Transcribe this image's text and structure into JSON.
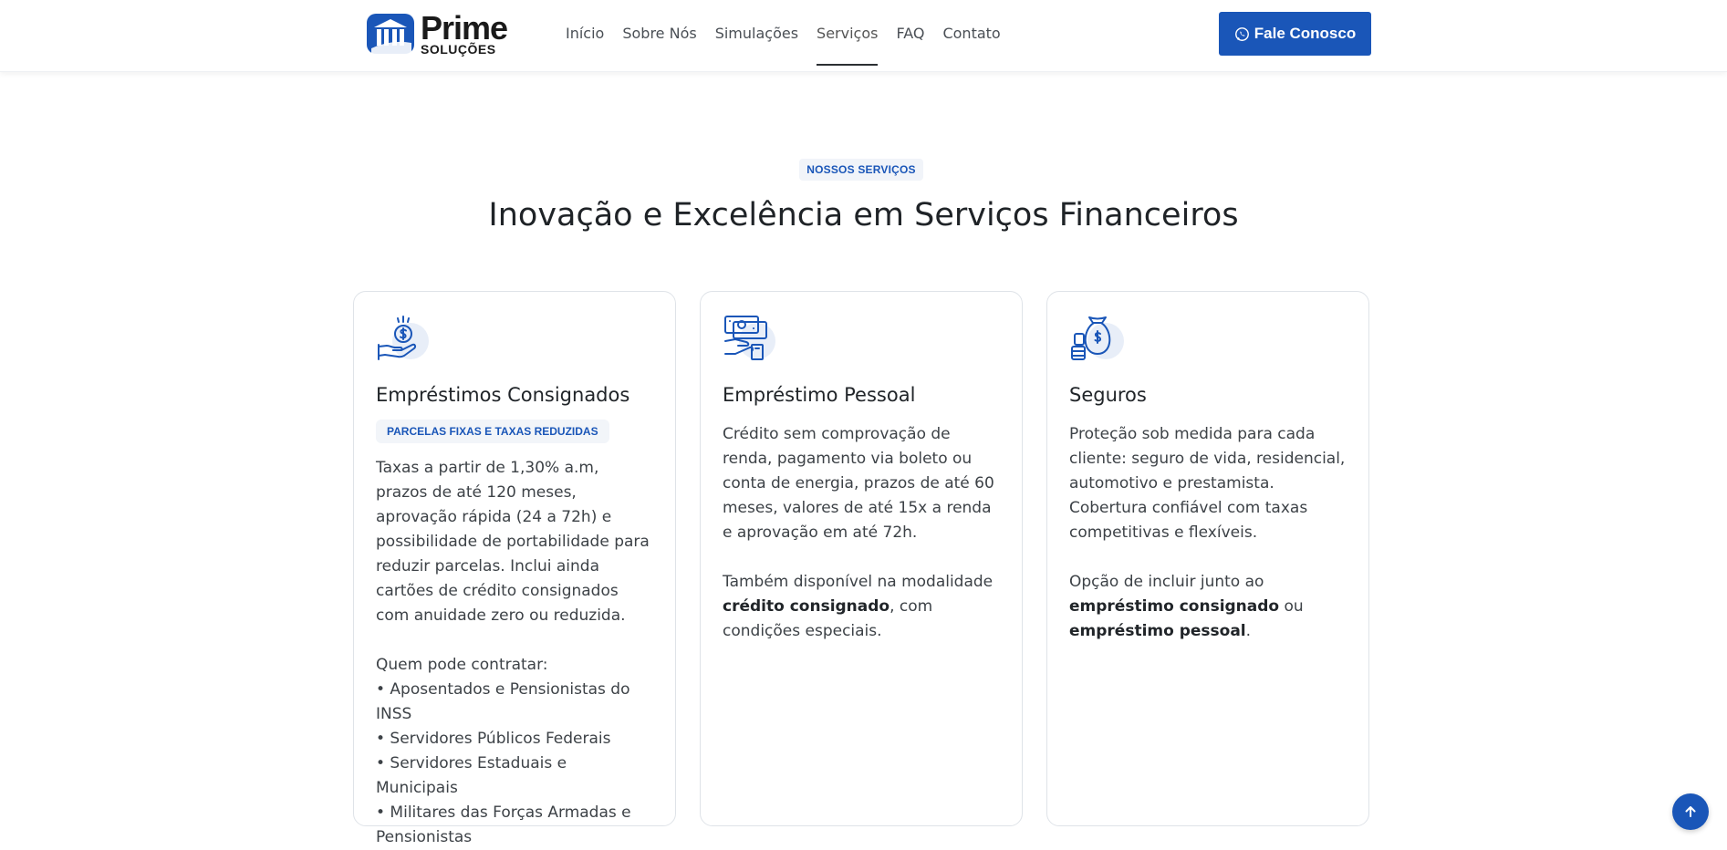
{
  "brand": {
    "name": "Prime",
    "subtitle": "SOLUÇÕES",
    "accent": "#1a56b8"
  },
  "nav": {
    "items": [
      {
        "label": "Início"
      },
      {
        "label": "Sobre Nós"
      },
      {
        "label": "Simulações"
      },
      {
        "label": "Serviços",
        "active": true
      },
      {
        "label": "FAQ"
      },
      {
        "label": "Contato"
      }
    ],
    "cta_label": "Fale Conosco",
    "cta_icon": "whatsapp-icon"
  },
  "section": {
    "eyebrow": "NOSSOS SERVIÇOS",
    "title": "Inovação e Excelência em Serviços Financeiros"
  },
  "cards": [
    {
      "icon": "hand-coin-icon",
      "title": "Empréstimos Consignados",
      "badge": "PARCELAS FIXAS E TAXAS REDUZIDAS",
      "p1": "Taxas a partir de 1,30% a.m, prazos de até 120 meses, aprovação rápida (24 a 72h) e possibilidade de portabilidade para reduzir parcelas. Inclui ainda cartões de crédito consignados com anuidade zero ou reduzida.",
      "who_label": "Quem pode contratar:",
      "list": [
        "• Aposentados e Pensionistas do INSS",
        "• Servidores Públicos Federais",
        "• Servidores Estaduais e Municipais",
        "• Militares das Forças Armadas e Pensionistas"
      ]
    },
    {
      "icon": "hand-money-icon",
      "title": "Empréstimo Pessoal",
      "p1": "Crédito sem comprovação de renda, pagamento via boleto ou conta de energia, prazos de até 60 meses, valores de até 15x a renda e aprovação em até 72h.",
      "p2_pre": "Também disponível na modalidade ",
      "p2_bold": "crédito consignado",
      "p2_post": ", com condições especiais."
    },
    {
      "icon": "money-bag-icon",
      "title": "Seguros",
      "p1": "Proteção sob medida para cada cliente: seguro de vida, residencial, automotivo e prestamista. Cobertura confiável com taxas competitivas e flexíveis.",
      "p2_pre": "Opção de incluir junto ao ",
      "p2_bold1": "empréstimo consignado",
      "p2_mid": " ou ",
      "p2_bold2": "empréstimo pessoal",
      "p2_post": "."
    }
  ],
  "scroll_top_icon": "arrow-up-icon"
}
